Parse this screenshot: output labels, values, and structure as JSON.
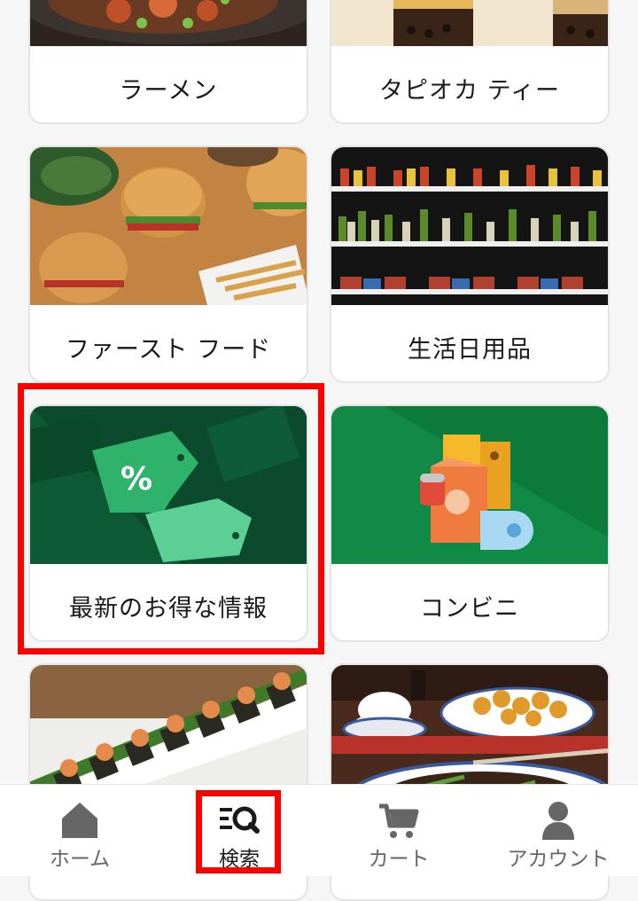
{
  "categories": [
    {
      "label": "ラーメン"
    },
    {
      "label": "タピオカ ティー"
    },
    {
      "label": "ファースト フード"
    },
    {
      "label": "生活日用品"
    },
    {
      "label": "最新のお得な情報"
    },
    {
      "label": "コンビニ"
    }
  ],
  "nav": {
    "home": "ホーム",
    "search": "検索",
    "cart": "カート",
    "account": "アカウント"
  },
  "colors": {
    "highlight": "#ff0000",
    "deal_green": "#0f5a36",
    "konbini_green": "#108a44"
  }
}
